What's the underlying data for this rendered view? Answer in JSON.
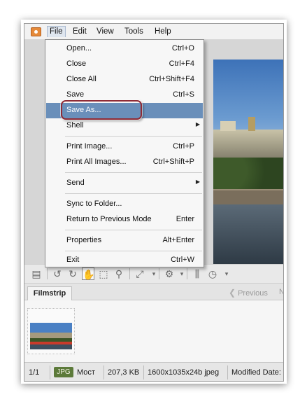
{
  "menubar": {
    "items": [
      "File",
      "Edit",
      "View",
      "Tools",
      "Help"
    ]
  },
  "file_menu": {
    "items": [
      {
        "label": "Open...",
        "shortcut": "Ctrl+O"
      },
      {
        "label": "Close",
        "shortcut": "Ctrl+F4"
      },
      {
        "label": "Close All",
        "shortcut": "Ctrl+Shift+F4"
      },
      {
        "label": "Save",
        "shortcut": "Ctrl+S"
      },
      {
        "label": "Save As...",
        "shortcut": ""
      },
      {
        "label": "Shell",
        "shortcut": ""
      },
      {
        "label": "Print Image...",
        "shortcut": "Ctrl+P"
      },
      {
        "label": "Print All Images...",
        "shortcut": "Ctrl+Shift+P"
      },
      {
        "label": "Send",
        "shortcut": ""
      },
      {
        "label": "Sync to Folder...",
        "shortcut": ""
      },
      {
        "label": "Return to Previous Mode",
        "shortcut": "Enter"
      },
      {
        "label": "Properties",
        "shortcut": "Alt+Enter"
      },
      {
        "label": "Exit",
        "shortcut": "Ctrl+W"
      }
    ],
    "highlighted": "Save As..."
  },
  "filmstrip": {
    "tab_label": "Filmstrip",
    "previous_label": "Previous",
    "next_label": "N"
  },
  "statusbar": {
    "position": "1/1",
    "format_badge": "JPG",
    "file_name": "Мост",
    "file_size": "207,3 KB",
    "file_info": "1600x1035x24b jpeg",
    "modified": "Modified Date:"
  },
  "colors": {
    "highlight": "#6a8fba",
    "callout": "#8f2b36",
    "format_badge": "#5c7a3a"
  }
}
